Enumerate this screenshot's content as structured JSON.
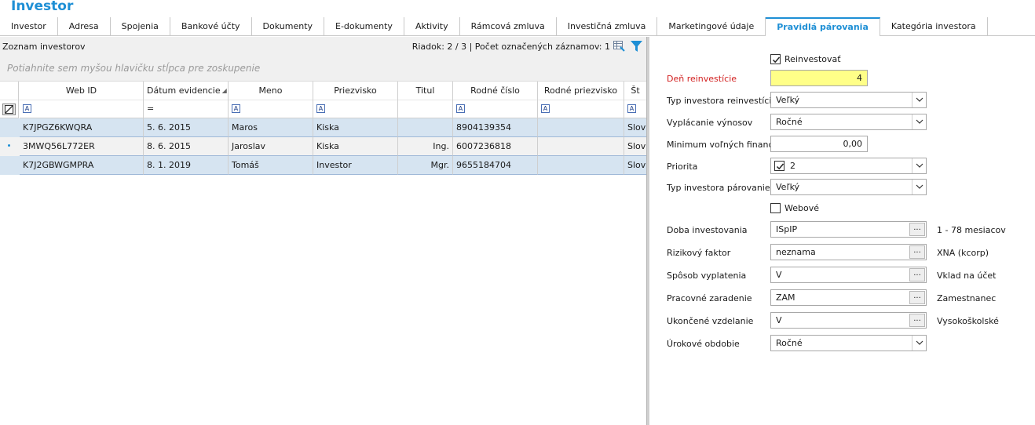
{
  "app_title": "Investor",
  "tabs": [
    {
      "label": "Investor",
      "active": false
    },
    {
      "label": "Adresa",
      "active": false
    },
    {
      "label": "Spojenia",
      "active": false
    },
    {
      "label": "Bankové účty",
      "active": false
    },
    {
      "label": "Dokumenty",
      "active": false
    },
    {
      "label": "E-dokumenty",
      "active": false
    },
    {
      "label": "Aktivity",
      "active": false
    },
    {
      "label": "Rámcová zmluva",
      "active": false
    },
    {
      "label": "Investičná zmluva",
      "active": false
    },
    {
      "label": "Marketingové údaje",
      "active": false
    },
    {
      "label": "Pravidlá párovania",
      "active": true
    },
    {
      "label": "Kategória investora",
      "active": false
    }
  ],
  "list": {
    "title": "Zoznam investorov",
    "status": "Riadok: 2 / 3 | Počet označených záznamov: 1",
    "group_hint": "Potiahnite sem myšou hlavičku stĺpca pre zoskupenie",
    "columns": [
      "Web ID",
      "Dátum evidencie",
      "Meno",
      "Priezvisko",
      "Titul",
      "Rodné číslo",
      "Rodné priezvisko",
      "Št"
    ],
    "filter_date_op": "=",
    "rows": [
      {
        "web_id": "K7JPGZ6KWQRA",
        "datum": "5. 6. 2015",
        "meno": "Maros",
        "priezvisko": "Kiska",
        "titul": "",
        "rodne_cislo": "8904139354",
        "rodne_priezvisko": "",
        "stat": "Slov"
      },
      {
        "web_id": "3MWQ56L772ER",
        "datum": "8. 6. 2015",
        "meno": "Jaroslav",
        "priezvisko": "Kiska",
        "titul": "Ing.",
        "rodne_cislo": "6007236818",
        "rodne_priezvisko": "",
        "stat": "Slov"
      },
      {
        "web_id": "K7J2GBWGMPRA",
        "datum": "8. 1. 2019",
        "meno": "Tomáš",
        "priezvisko": "Investor",
        "titul": "Mgr.",
        "rodne_cislo": "9655184704",
        "rodne_priezvisko": "",
        "stat": "Slov"
      }
    ]
  },
  "form": {
    "reinvestovat_label": "Reinvestovať",
    "reinvestovat_checked": true,
    "den_label": "Deň reinvestície",
    "den_value": "4",
    "typ_reinvest_label": "Typ investora reinvestícia",
    "typ_reinvest_value": "Veľký",
    "vyplacanie_label": "Vyplácanie výnosov",
    "vyplacanie_value": "Ročné",
    "minimum_label": "Minimum voľných financií",
    "minimum_value": "0,00",
    "priorita_label": "Priorita",
    "priorita_value": "2",
    "priorita_checked": true,
    "typ_parovanie_label": "Typ investora párovanie",
    "typ_parovanie_value": "Veľký",
    "webove_label": "Webové",
    "webove_checked": false,
    "doba_label": "Doba investovania",
    "doba_value": "ISpIP",
    "doba_desc": "1 - 78 mesiacov",
    "rizikovy_label": "Rizikový faktor",
    "rizikovy_value": "neznama",
    "rizikovy_desc": "XNA (kcorp)",
    "sposob_label": "Spôsob vyplatenia",
    "sposob_value": "V",
    "sposob_desc": "Vklad na účet",
    "pracovne_label": "Pracovné zaradenie",
    "pracovne_value": "ZAM",
    "pracovne_desc": "Zamestnanec",
    "vzdelanie_label": "Ukončené vzdelanie",
    "vzdelanie_value": "V",
    "vzdelanie_desc": "Vysokoškolské",
    "urokove_label": "Úrokové obdobie",
    "urokove_value": "Ročné",
    "dots": "..."
  },
  "colors": {
    "accent": "#1e8fd5",
    "required": "#d21f1f",
    "highlight": "#ffff88",
    "row_selected": "#d6e4f1"
  }
}
